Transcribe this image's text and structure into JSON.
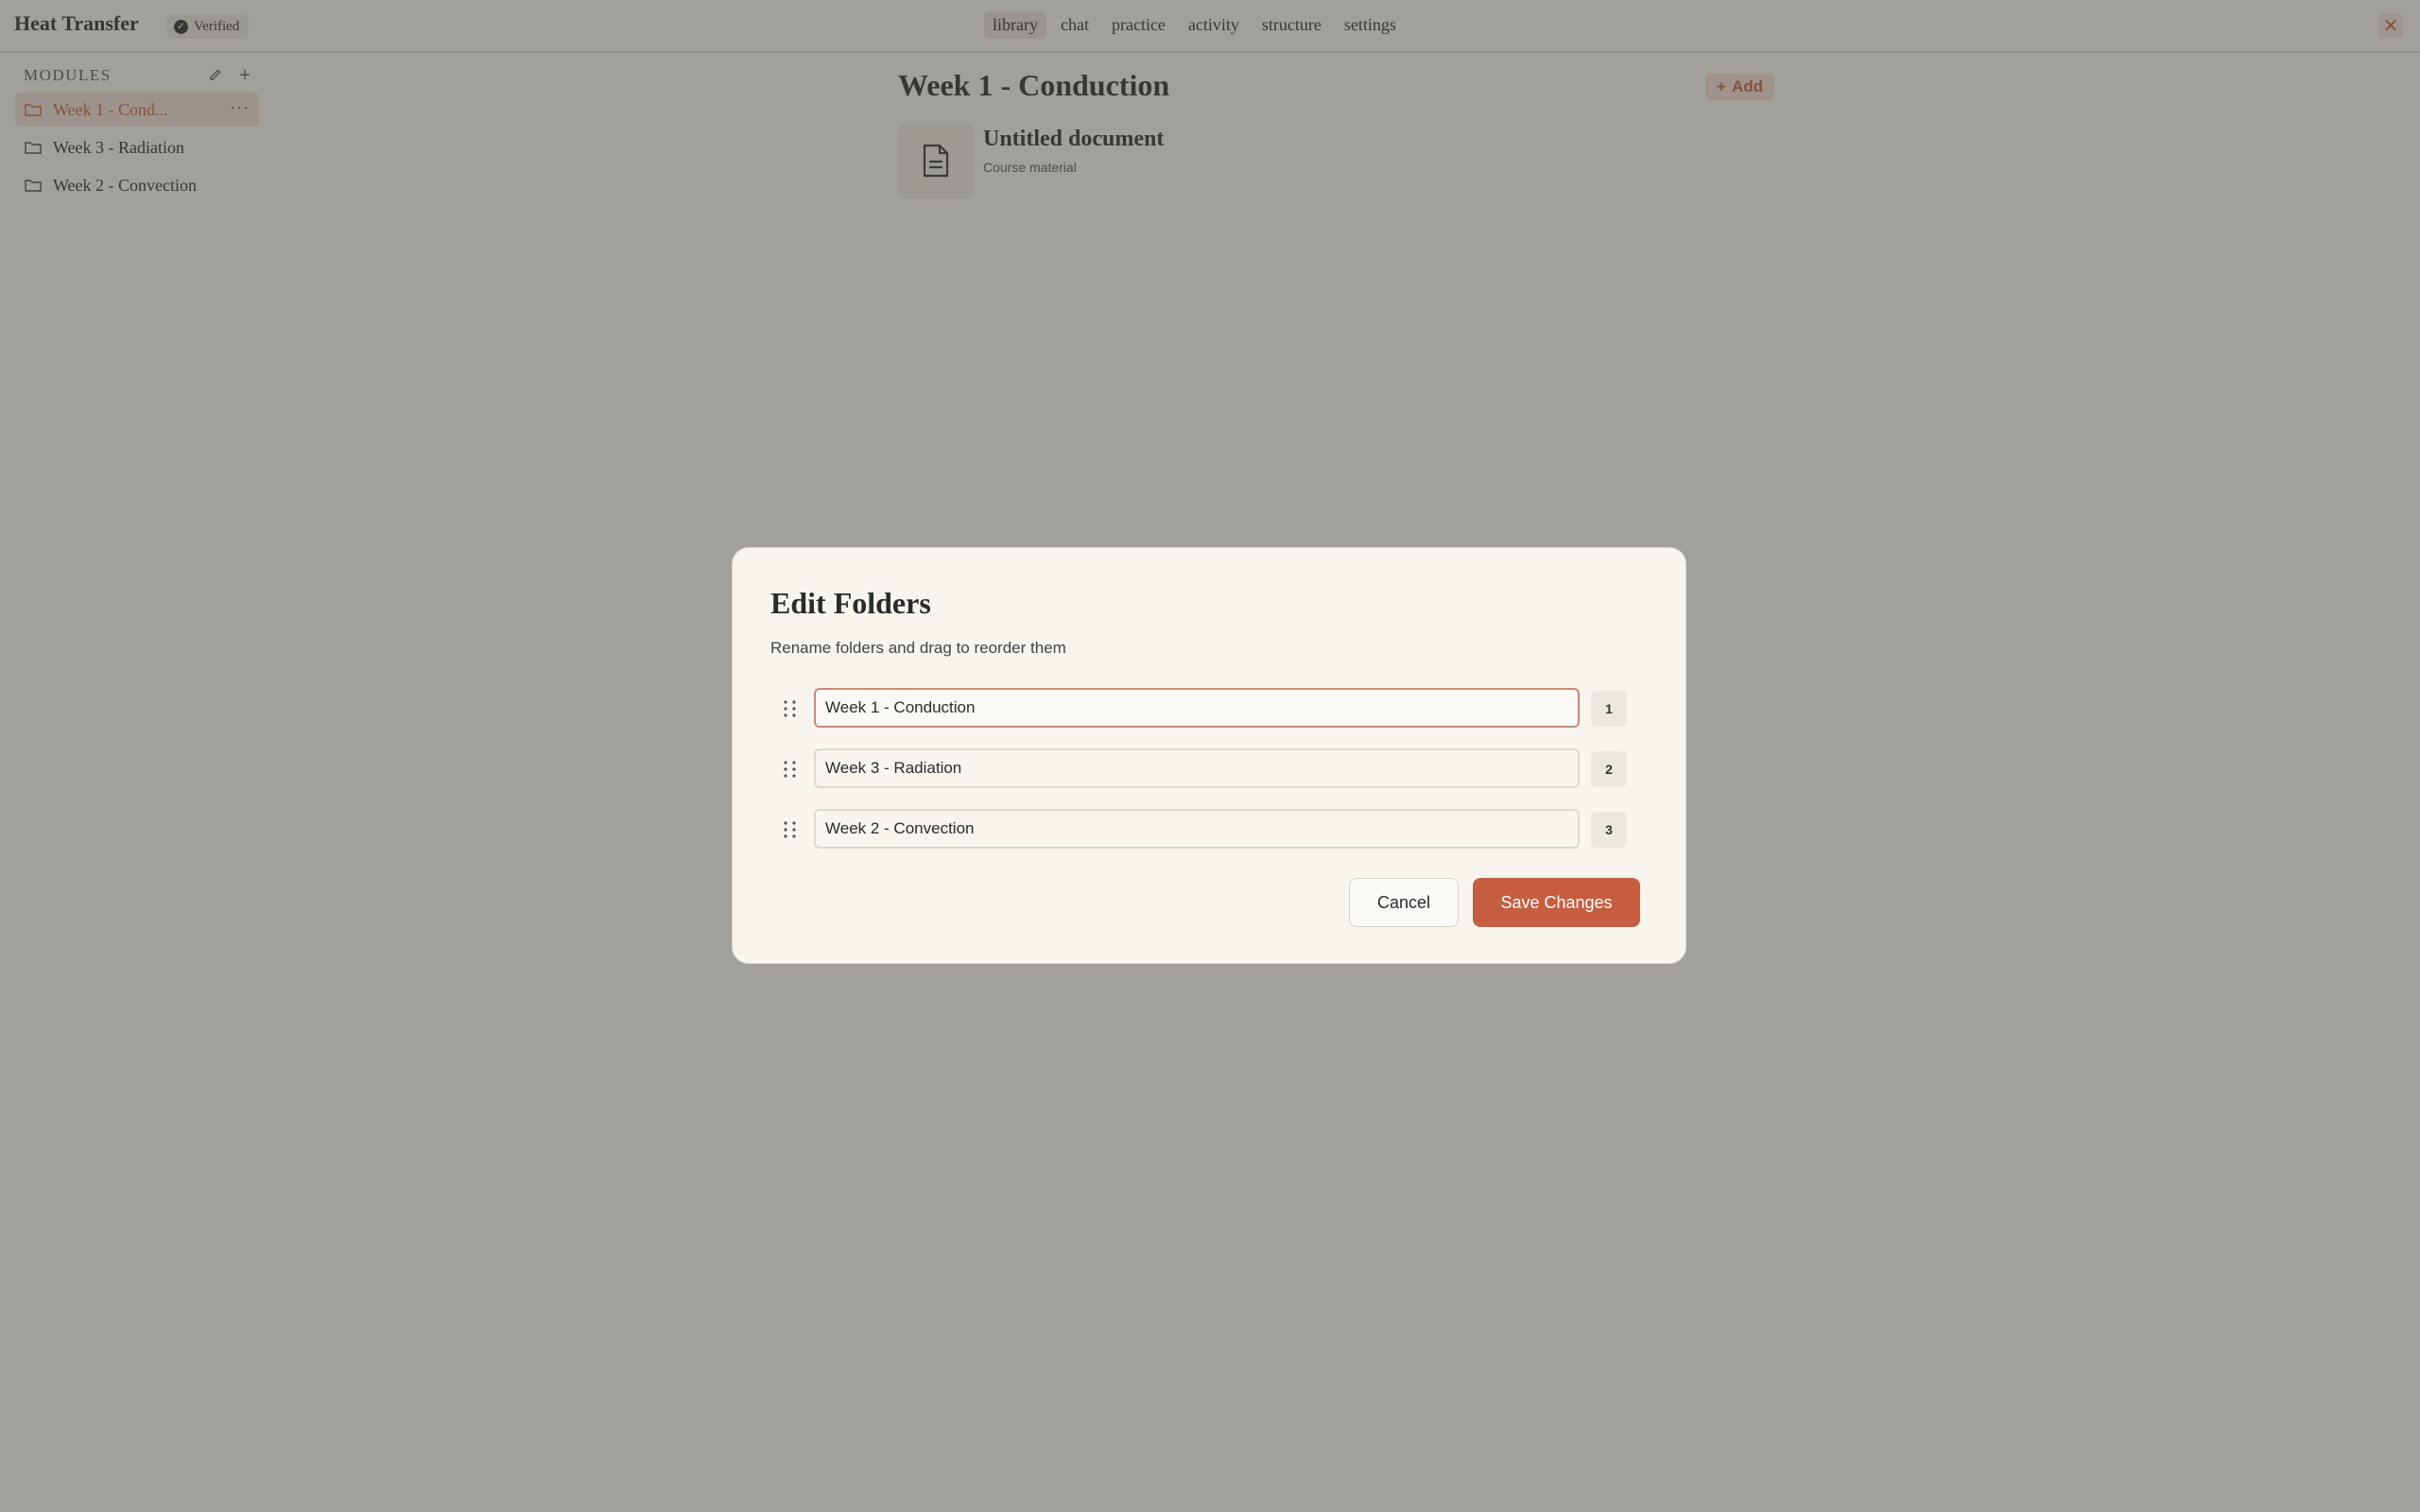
{
  "app": {
    "title": "Heat Transfer",
    "verified_label": "Verified",
    "close_glyph": "✕"
  },
  "nav": {
    "tabs": [
      {
        "label": "library",
        "active": true
      },
      {
        "label": "chat",
        "active": false
      },
      {
        "label": "practice",
        "active": false
      },
      {
        "label": "activity",
        "active": false
      },
      {
        "label": "structure",
        "active": false
      },
      {
        "label": "settings",
        "active": false
      }
    ]
  },
  "sidebar": {
    "section_label": "MODULES",
    "items": [
      {
        "label": "Week 1 - Cond...",
        "active": true
      },
      {
        "label": "Week 3 - Radiation",
        "active": false
      },
      {
        "label": "Week 2 - Convection",
        "active": false
      }
    ],
    "more_glyph": "···"
  },
  "main": {
    "title": "Week 1 - Conduction",
    "add_label": "Add",
    "document": {
      "title": "Untitled document",
      "subtitle": "Course material"
    }
  },
  "modal": {
    "title": "Edit Folders",
    "subtitle": "Rename folders and drag to reorder them",
    "rows": [
      {
        "value": "Week 1 - Conduction",
        "order": "1"
      },
      {
        "value": "Week 3 - Radiation",
        "order": "2"
      },
      {
        "value": "Week 2 - Convection",
        "order": "3"
      }
    ],
    "cancel_label": "Cancel",
    "save_label": "Save Changes"
  },
  "colors": {
    "accent": "#c55d3e",
    "background": "#f7f4ee",
    "overlay": "rgba(70,68,62,0.48)"
  }
}
